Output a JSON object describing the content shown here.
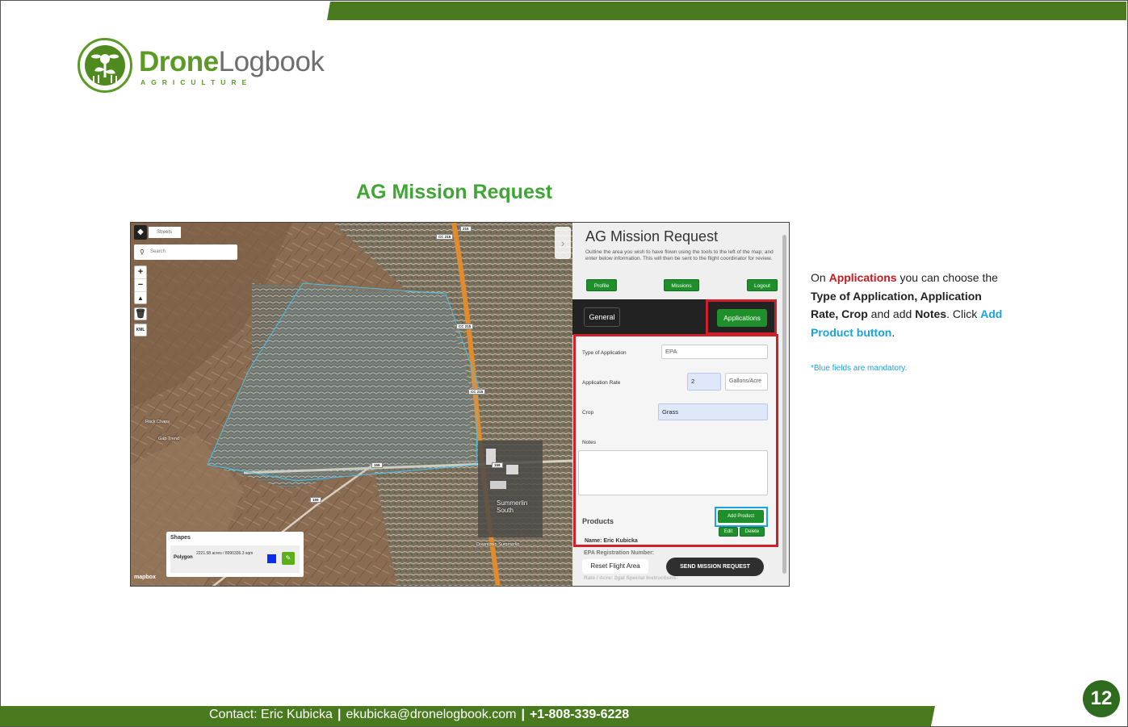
{
  "brand": {
    "name_part1": "Drone",
    "name_part2": "Logbook",
    "tagline": "AGRICULTURE"
  },
  "heading": "AG Mission Request",
  "screenshot": {
    "map": {
      "style_label": "Streets",
      "search_placeholder": "Search",
      "kml_label": "KML",
      "place_labels": [
        "Rock Chaps",
        "Gap Trend",
        "Summerlin South",
        "Downtown Summerlin"
      ],
      "road_shields": [
        "CC 215",
        "215",
        "CC 215",
        "CC 215",
        "159",
        "159",
        "159"
      ],
      "shapes": {
        "title": "Shapes",
        "type": "Polygon",
        "area": "2221.58 acres / 8990336.3 sqm",
        "color": "#0b2df0"
      },
      "attribution": "mapbox"
    },
    "form": {
      "title": "AG Mission Request",
      "description": "Outline the area you wish to have flown using the tools to the left of the map; and enter below information. This will then be sent to the flight coordinator for review.",
      "nav": {
        "profile": "Profile",
        "missions": "Missions",
        "logout": "Logout"
      },
      "tabs": {
        "general": "General",
        "applications": "Applications"
      },
      "type_of_application": {
        "label": "Type of Application",
        "value": "EPA"
      },
      "application_rate": {
        "label": "Application Rate",
        "value": "2",
        "unit": "Gallons/Acre"
      },
      "crop": {
        "label": "Crop",
        "value": "Grass"
      },
      "notes": {
        "label": "Notes"
      },
      "products": {
        "label": "Products",
        "add_button": "Add Product",
        "edit_button": "Edit",
        "delete_button": "Delete"
      },
      "name_line": "Name: Eric Kubicka",
      "epa_line": "EPA Registration Number:",
      "faded_line": "Rate / Acre: 2gal    Special Instructions:",
      "reset_button": "Reset Flight Area",
      "send_button": "SEND MISSION REQUEST"
    }
  },
  "side_note": {
    "p1": "On ",
    "applications": "Applications",
    "p2": " you can choose the ",
    "bold1": "Type of Application, Application Rate, Crop",
    "p3": " and add ",
    "bold2": "Notes",
    "p4": ". Click ",
    "add_product": "Add Product button",
    "p5": ".",
    "mandatory": "*Blue fields are mandatory."
  },
  "footer": {
    "contact": "Contact: Eric Kubicka",
    "sep1": "|",
    "email": "ekubicka@dronelogbook.com",
    "sep2": "|",
    "phone": "+1-808-339-6228"
  },
  "page_number": "12",
  "colors": {
    "brand_green": "#4a7a1e",
    "heading_green": "#3fa535",
    "highlight_red": "#d0202a",
    "highlight_blue": "#1aa3e0"
  }
}
